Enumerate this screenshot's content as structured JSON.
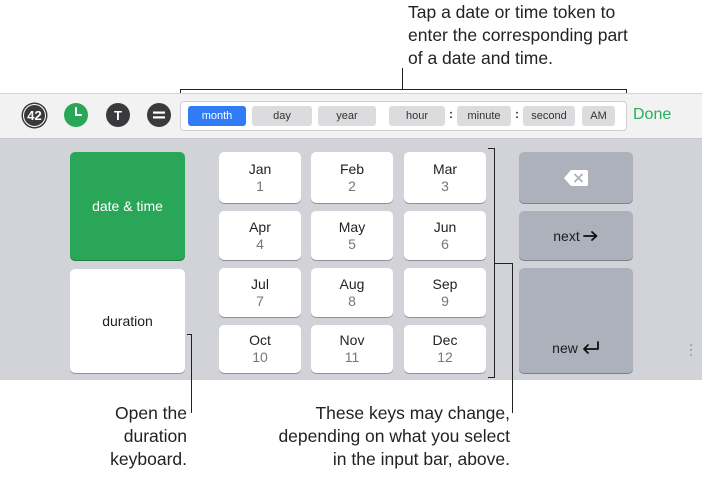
{
  "callouts": {
    "top": [
      "Tap a date or time token to",
      "enter the corresponding part",
      "of a date and time."
    ],
    "duration": [
      "Open the",
      "duration",
      "keyboard."
    ],
    "keys": [
      "These keys may change,",
      "depending on what you select",
      "in the input bar, above."
    ]
  },
  "input_bar": {
    "buttons": [
      {
        "label": "42",
        "name": "number-format-button",
        "color": "#3a3a3c"
      },
      {
        "label": "",
        "name": "clock-icon",
        "color": "#2aa658"
      },
      {
        "label": "T",
        "name": "text-format-button",
        "color": "#3a3a3c"
      },
      {
        "label": "",
        "name": "equals-icon",
        "color": "#3a3a3c"
      }
    ],
    "tokens": [
      {
        "label": "month",
        "selected": true
      },
      {
        "label": "day",
        "selected": false
      },
      {
        "label": "year",
        "selected": false
      },
      {
        "label": "hour",
        "selected": false
      },
      {
        "label": "minute",
        "selected": false
      },
      {
        "label": "second",
        "selected": false
      },
      {
        "label": "AM",
        "selected": false
      }
    ],
    "separators": [
      ":",
      ":"
    ],
    "done_label": "Done",
    "accent": "#2f7cf6",
    "done_color": "#27ae5a"
  },
  "keyboard": {
    "mode_keys": [
      {
        "label": "date & time",
        "active": true
      },
      {
        "label": "duration",
        "active": false
      }
    ],
    "months": [
      {
        "name": "Jan",
        "num": "1"
      },
      {
        "name": "Feb",
        "num": "2"
      },
      {
        "name": "Mar",
        "num": "3"
      },
      {
        "name": "Apr",
        "num": "4"
      },
      {
        "name": "May",
        "num": "5"
      },
      {
        "name": "Jun",
        "num": "6"
      },
      {
        "name": "Jul",
        "num": "7"
      },
      {
        "name": "Aug",
        "num": "8"
      },
      {
        "name": "Sep",
        "num": "9"
      },
      {
        "name": "Oct",
        "num": "10"
      },
      {
        "name": "Nov",
        "num": "11"
      },
      {
        "name": "Dec",
        "num": "12"
      }
    ],
    "next_label": "next",
    "new_label": "new",
    "icons": {
      "delete": "delete-icon",
      "next": "arrow-right-icon",
      "new": "return-icon"
    },
    "active_color": "#2aa658"
  }
}
